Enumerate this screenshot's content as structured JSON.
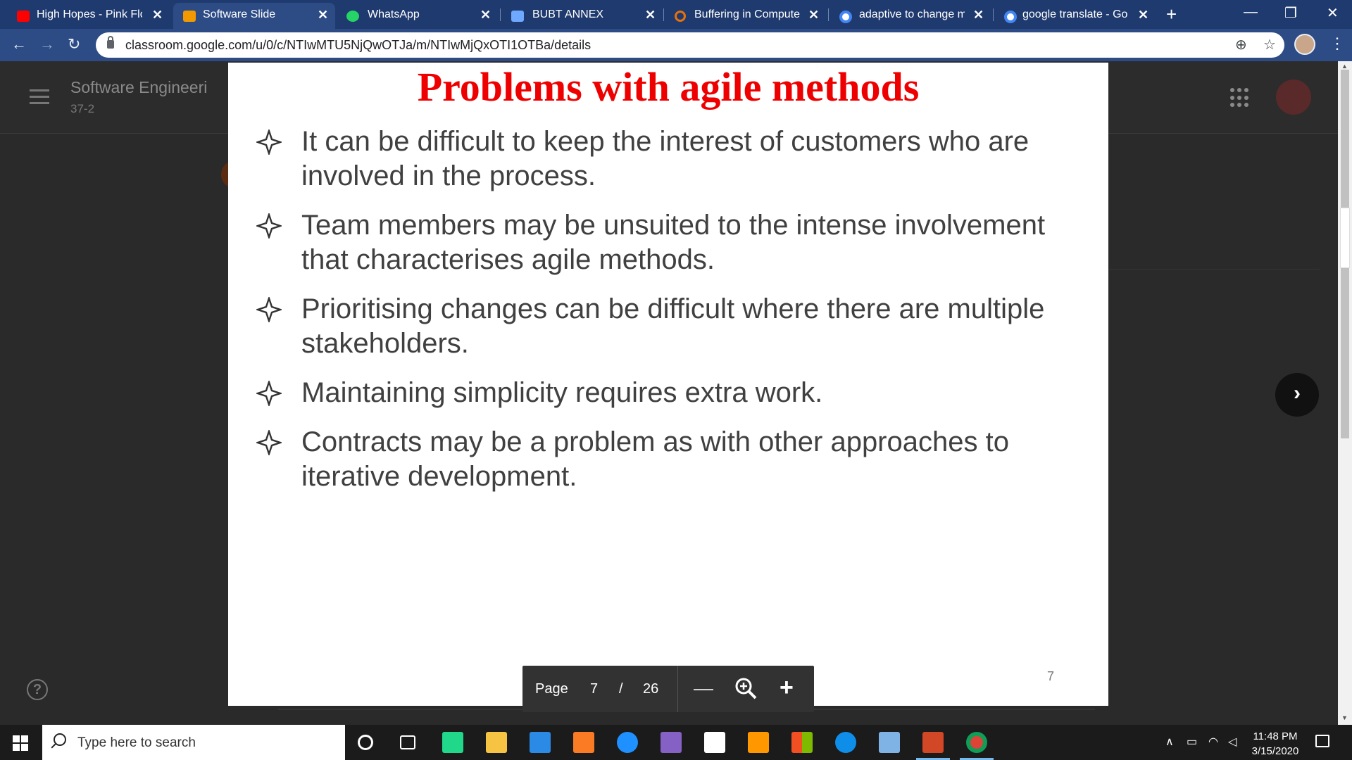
{
  "browser": {
    "tabs": [
      {
        "title": "High Hopes - Pink Floy",
        "favicon_color": "#ff0000",
        "icon": "youtube-icon"
      },
      {
        "title": "Software Slide",
        "favicon_color": "#f29900",
        "icon": "classroom-icon",
        "active": true
      },
      {
        "title": "WhatsApp",
        "favicon_color": "#25d366",
        "icon": "whatsapp-icon"
      },
      {
        "title": "BUBT ANNEX",
        "favicon_color": "#6ea8ff",
        "icon": "bubt-icon"
      },
      {
        "title": "Buffering in Computer",
        "favicon_color": "#e8710a",
        "icon": "circle-o-icon"
      },
      {
        "title": "adaptive to change me",
        "favicon_color": "#4285f4",
        "icon": "google-icon"
      },
      {
        "title": "google translate - Goo",
        "favicon_color": "#4285f4",
        "icon": "google-icon"
      }
    ],
    "url": "classroom.google.com/u/0/c/NTIwMTU5NjQwOTJa/m/NTIwMjQxOTI1OTBa/details"
  },
  "classroom": {
    "course_title": "Software Engineeri",
    "course_section": "37-2"
  },
  "slide": {
    "title": "Problems with agile methods",
    "title_color": "#ee0000",
    "bullets": [
      "It can be difficult to keep the interest of customers who are involved in the process.",
      "Team members may be unsuited to the intense involvement that characterises agile methods.",
      "Prioritising changes can be difficult where there are multiple stakeholders.",
      "Maintaining simplicity requires extra work.",
      "Contracts may be a problem as with other approaches to iterative development."
    ],
    "slide_number": "7"
  },
  "viewer": {
    "page_label": "Page",
    "current_page": "7",
    "separator": "/",
    "total_pages": "26"
  },
  "taskbar": {
    "search_placeholder": "Type here to search",
    "time": "11:48 PM",
    "date": "3/15/2020"
  }
}
